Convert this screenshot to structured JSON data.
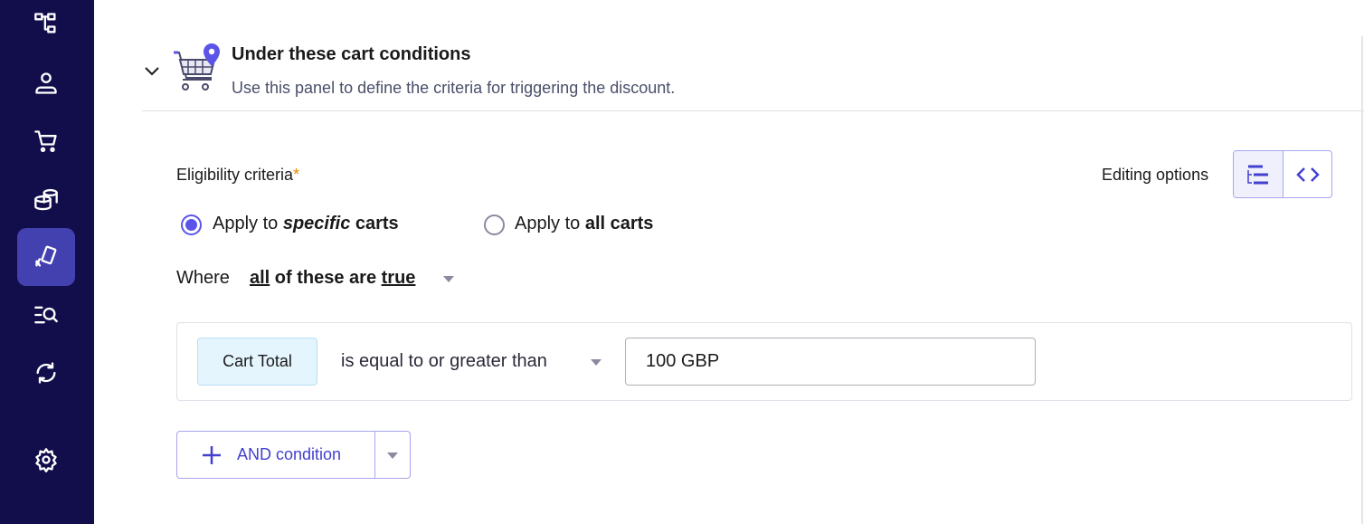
{
  "sidebar": {
    "items": [
      {
        "icon": "hierarchy-icon",
        "active": false
      },
      {
        "icon": "user-icon",
        "active": false
      },
      {
        "icon": "cart-icon",
        "active": false
      },
      {
        "icon": "coins-icon",
        "active": false
      },
      {
        "icon": "promotion-card-icon",
        "active": true
      },
      {
        "icon": "search-list-icon",
        "active": false
      },
      {
        "icon": "sync-icon",
        "active": false
      },
      {
        "icon": "gear-icon",
        "active": false
      }
    ]
  },
  "panel": {
    "title": "Under these cart conditions",
    "subtitle": "Use this panel to define the criteria for triggering the discount.",
    "expanded": true
  },
  "criteria": {
    "label": "Eligibility criteria",
    "required": "*",
    "editing_label": "Editing options",
    "radio_specific": {
      "pre": "Apply to ",
      "em": "specific",
      "post": " carts",
      "selected": true
    },
    "radio_all": {
      "pre": "Apply to ",
      "bold": "all carts",
      "selected": false
    },
    "where": {
      "label": "Where",
      "q1": "all",
      "q2": " of these are ",
      "q3": "true"
    },
    "condition": {
      "field": "Cart Total",
      "operator": "is equal to or greater than",
      "value": "100 GBP"
    },
    "and_button": "AND condition"
  },
  "colors": {
    "sidebar": "#120e4b",
    "accent": "#5a55e8",
    "active_nav": "#4340b0"
  }
}
